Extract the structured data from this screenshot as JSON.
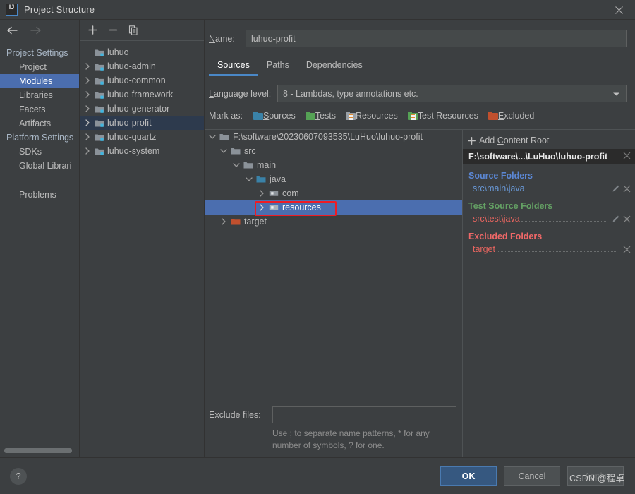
{
  "window": {
    "title": "Project Structure",
    "app_icon": "intellij-idea-logo",
    "close_icon": "close-icon"
  },
  "nav": {
    "back_icon": "arrow-left-icon",
    "forward_icon": "arrow-right-icon"
  },
  "settings_sidebar": {
    "groups": [
      {
        "label": "Project Settings",
        "items": [
          {
            "label": "Project",
            "selected": false
          },
          {
            "label": "Modules",
            "selected": true
          },
          {
            "label": "Libraries",
            "selected": false
          },
          {
            "label": "Facets",
            "selected": false
          },
          {
            "label": "Artifacts",
            "selected": false
          }
        ]
      },
      {
        "label": "Platform Settings",
        "items": [
          {
            "label": "SDKs",
            "selected": false
          },
          {
            "label": "Global Librari",
            "selected": false
          }
        ]
      }
    ],
    "problems_label": "Problems"
  },
  "modules_toolbar": {
    "add_icon": "plus-icon",
    "remove_icon": "minus-icon",
    "copy_icon": "copy-icon"
  },
  "modules_list": [
    {
      "label": "luhuo",
      "expandable": false,
      "selected": false
    },
    {
      "label": "luhuo-admin",
      "expandable": true,
      "selected": false
    },
    {
      "label": "luhuo-common",
      "expandable": true,
      "selected": false
    },
    {
      "label": "luhuo-framework",
      "expandable": true,
      "selected": false
    },
    {
      "label": "luhuo-generator",
      "expandable": true,
      "selected": false
    },
    {
      "label": "luhuo-profit",
      "expandable": true,
      "selected": true
    },
    {
      "label": "luhuo-quartz",
      "expandable": true,
      "selected": false
    },
    {
      "label": "luhuo-system",
      "expandable": true,
      "selected": false
    }
  ],
  "module_editor": {
    "name_label": "Name:",
    "name_value": "luhuo-profit",
    "tabs": [
      {
        "label": "Sources",
        "active": true
      },
      {
        "label": "Paths",
        "active": false
      },
      {
        "label": "Dependencies",
        "active": false
      }
    ],
    "language_level_label": "Language level:",
    "language_level_value": "8 - Lambdas, type annotations etc.",
    "dropdown_icon": "chevron-down-icon",
    "mark_as_label": "Mark as:",
    "mark_as_options": [
      {
        "label": "Sources",
        "color": "#3a82a8"
      },
      {
        "label": "Tests",
        "color": "#55a255"
      },
      {
        "label": "Resources",
        "color": "#9aa0a6"
      },
      {
        "label": "Test Resources",
        "color": "#55a255"
      },
      {
        "label": "Excluded",
        "color": "#c1502e"
      }
    ]
  },
  "source_tree": [
    {
      "label": "F:\\software\\20230607093535\\LuHuo\\luhuo-profit",
      "depth": 0,
      "state": "expanded",
      "icon": "folder-gray",
      "selected": false
    },
    {
      "label": "src",
      "depth": 1,
      "state": "expanded",
      "icon": "folder-gray",
      "selected": false
    },
    {
      "label": "main",
      "depth": 2,
      "state": "expanded",
      "icon": "folder-gray",
      "selected": false
    },
    {
      "label": "java",
      "depth": 3,
      "state": "expanded",
      "icon": "folder-source-blue",
      "selected": false
    },
    {
      "label": "com",
      "depth": 4,
      "state": "collapsed",
      "icon": "folder-package",
      "selected": false
    },
    {
      "label": "resources",
      "depth": 4,
      "state": "collapsed",
      "icon": "folder-package",
      "selected": true
    },
    {
      "label": "target",
      "depth": 1,
      "state": "collapsed",
      "icon": "folder-excluded-orange",
      "selected": false
    }
  ],
  "exclude": {
    "label": "Exclude files:",
    "value": "",
    "hint_line1": "Use ; to separate name patterns, * for any",
    "hint_line2": "number of symbols, ? for one."
  },
  "content_roots": {
    "add_label": "Add Content Root",
    "add_icon": "plus-icon",
    "root_path": "F:\\software\\...\\LuHuo\\luhuo-profit",
    "root_close_icon": "close-icon",
    "sections": [
      {
        "title": "Source Folders",
        "color": "#5b87d4",
        "entries": [
          {
            "path": "src\\main\\java",
            "path_color": "blue",
            "edit_icon": "pencil-icon",
            "remove_icon": "close-icon"
          }
        ]
      },
      {
        "title": "Test Source Folders",
        "color": "#64a064",
        "entries": [
          {
            "path": "src\\test\\java",
            "path_color": "red",
            "edit_icon": "pencil-icon",
            "remove_icon": "close-icon"
          }
        ]
      },
      {
        "title": "Excluded Folders",
        "color": "#f06868",
        "entries": [
          {
            "path": "target",
            "path_color": "red",
            "edit_icon": null,
            "remove_icon": "close-icon"
          }
        ]
      }
    ]
  },
  "footer": {
    "help_icon": "question-mark-icon",
    "ok_label": "OK",
    "cancel_label": "Cancel",
    "apply_label": "Apply",
    "watermark": "CSDN @程卓"
  }
}
